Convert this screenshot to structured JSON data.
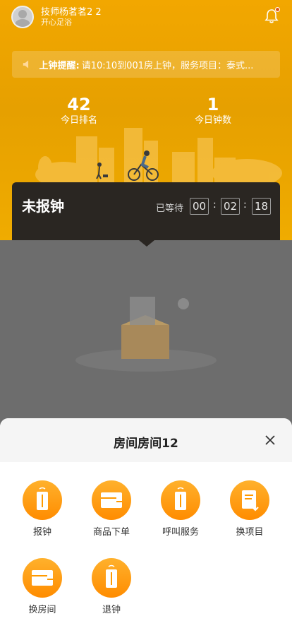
{
  "user": {
    "name": "技师杨茗茗2 2",
    "store": "开心足浴"
  },
  "notice": {
    "title": "上钟提醒:",
    "message": "请10:10到001房上钟，服务项目：泰式..."
  },
  "stats": [
    {
      "value": "42",
      "label": "今日排名"
    },
    {
      "value": "1",
      "label": "今日钟数"
    }
  ],
  "status": {
    "title": "未报钟",
    "wait_label": "已等待",
    "timer": {
      "h": "00",
      "m": "02",
      "s": "18"
    },
    "sep": ":"
  },
  "sheet": {
    "title": "房间房间12",
    "actions": [
      {
        "label": "报钟",
        "icon": "phone-icon"
      },
      {
        "label": "商品下单",
        "icon": "order-icon"
      },
      {
        "label": "呼叫服务",
        "icon": "phone-icon"
      },
      {
        "label": "换项目",
        "icon": "swap-doc-icon"
      },
      {
        "label": "换房间",
        "icon": "order-icon"
      },
      {
        "label": "退钟",
        "icon": "phone-icon"
      }
    ]
  },
  "colors": {
    "accent": "#ff9a00",
    "header": "#f2a700",
    "overlay": "#6d6d6d",
    "card": "#2a2622"
  }
}
